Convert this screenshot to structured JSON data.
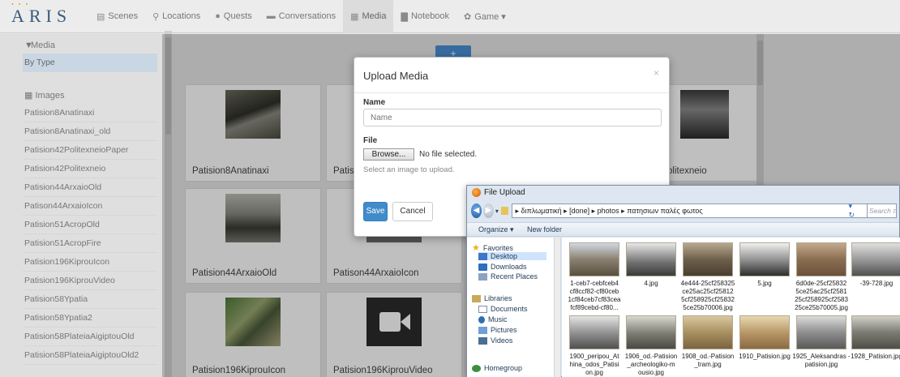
{
  "brand": {
    "name": "ARIS",
    "dots": "• • •"
  },
  "nav": [
    {
      "icon": "▤",
      "label": "Scenes"
    },
    {
      "icon": "⚲",
      "label": "Locations"
    },
    {
      "icon": "●",
      "label": "Quests"
    },
    {
      "icon": "▬",
      "label": "Conversations"
    },
    {
      "icon": "▦",
      "label": "Media"
    },
    {
      "icon": "▇",
      "label": "Notebook"
    },
    {
      "icon": "✿",
      "label": "Game ▾"
    }
  ],
  "sidebar": {
    "heading": "Media",
    "filter": "By Type",
    "section": "Images",
    "items": [
      "Patision8Anatinaxi",
      "Patision8Anatinaxi_old",
      "Patision42PolitexneioPaper",
      "Patision42Politexneio",
      "Patision44ArxaioOld",
      "Patison44ArxaioIcon",
      "Patision51AcropOld",
      "Patision51AcropFire",
      "Patision196KiprouIcon",
      "Patision196KiprouVideo",
      "Patision58Ypatia",
      "Patision58Ypatia2",
      "Patision58PlateiaAigiptouOld",
      "Patision58PlateiaAigiptouOld2"
    ]
  },
  "upload_button": "+",
  "cards": [
    {
      "label": "Patision8Anatinaxi"
    },
    {
      "label": "Patis"
    },
    {
      "label": "olitexneio"
    },
    {
      "label": "Patision44ArxaioOld"
    },
    {
      "label": "Patison44ArxaioIcon"
    },
    {
      "label": "Patision196KiprouIcon"
    },
    {
      "label": "Patision196KiprouVideo"
    }
  ],
  "modal": {
    "title": "Upload Media",
    "close": "×",
    "name_label": "Name",
    "name_placeholder": "Name",
    "file_label": "File",
    "browse": "Browse...",
    "file_status": "No file selected.",
    "help": "Select an image to upload.",
    "save": "Save",
    "cancel": "Cancel"
  },
  "file_dialog": {
    "title": "File Upload",
    "path": "▸ διπλωματική ▸ [done] ▸ photos ▸ πατησιων παλές φωτος",
    "search_placeholder": "Search πα",
    "toolbar": {
      "organize": "Organize ▾",
      "new_folder": "New folder"
    },
    "nav": {
      "favorites": "Favorites",
      "desktop": "Desktop",
      "downloads": "Downloads",
      "recent": "Recent Places",
      "libraries": "Libraries",
      "documents": "Documents",
      "music": "Music",
      "pictures": "Pictures",
      "videos": "Videos",
      "homegroup": "Homegroup"
    },
    "files": [
      "1-ceb7-cebfceb4 cf8ccf82-cf80ceb 1cf84ceb7cf83cea fcf89cebd-cf80...",
      "4.jpg",
      "4e444-25cf258325 ce25ac25cf25812 5cf258925cf25832 5ce25b70006.jpg",
      "5.jpg",
      "6d0de-25cf25832 5ce25ac25cf2581 25cf258925cf2583 25ce25b70005.jpg",
      "-39-728.jpg",
      "1900_peripou_At hina_odos_Patisi on.jpg",
      "1906_od.-Patision _archeologiko-m ousio.jpg",
      "1908_od.-Patision _tram.jpg",
      "1910_Patision.jpg",
      "1925_Aleksandras -patision.jpg",
      "1928_Patision.jpg"
    ]
  },
  "colors": {
    "accent": "#428bca",
    "overlay": "#000000",
    "brand": "#3a5a7a"
  }
}
